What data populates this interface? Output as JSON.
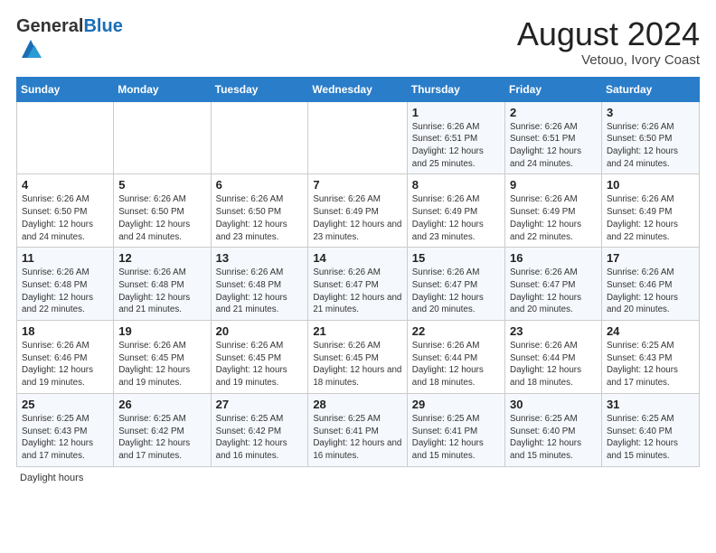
{
  "header": {
    "logo_general": "General",
    "logo_blue": "Blue",
    "month_title": "August 2024",
    "location": "Vetouo, Ivory Coast"
  },
  "days_of_week": [
    "Sunday",
    "Monday",
    "Tuesday",
    "Wednesday",
    "Thursday",
    "Friday",
    "Saturday"
  ],
  "weeks": [
    [
      {
        "day": "",
        "info": ""
      },
      {
        "day": "",
        "info": ""
      },
      {
        "day": "",
        "info": ""
      },
      {
        "day": "",
        "info": ""
      },
      {
        "day": "1",
        "info": "Sunrise: 6:26 AM\nSunset: 6:51 PM\nDaylight: 12 hours and 25 minutes."
      },
      {
        "day": "2",
        "info": "Sunrise: 6:26 AM\nSunset: 6:51 PM\nDaylight: 12 hours and 24 minutes."
      },
      {
        "day": "3",
        "info": "Sunrise: 6:26 AM\nSunset: 6:50 PM\nDaylight: 12 hours and 24 minutes."
      }
    ],
    [
      {
        "day": "4",
        "info": "Sunrise: 6:26 AM\nSunset: 6:50 PM\nDaylight: 12 hours and 24 minutes."
      },
      {
        "day": "5",
        "info": "Sunrise: 6:26 AM\nSunset: 6:50 PM\nDaylight: 12 hours and 24 minutes."
      },
      {
        "day": "6",
        "info": "Sunrise: 6:26 AM\nSunset: 6:50 PM\nDaylight: 12 hours and 23 minutes."
      },
      {
        "day": "7",
        "info": "Sunrise: 6:26 AM\nSunset: 6:49 PM\nDaylight: 12 hours and 23 minutes."
      },
      {
        "day": "8",
        "info": "Sunrise: 6:26 AM\nSunset: 6:49 PM\nDaylight: 12 hours and 23 minutes."
      },
      {
        "day": "9",
        "info": "Sunrise: 6:26 AM\nSunset: 6:49 PM\nDaylight: 12 hours and 22 minutes."
      },
      {
        "day": "10",
        "info": "Sunrise: 6:26 AM\nSunset: 6:49 PM\nDaylight: 12 hours and 22 minutes."
      }
    ],
    [
      {
        "day": "11",
        "info": "Sunrise: 6:26 AM\nSunset: 6:48 PM\nDaylight: 12 hours and 22 minutes."
      },
      {
        "day": "12",
        "info": "Sunrise: 6:26 AM\nSunset: 6:48 PM\nDaylight: 12 hours and 21 minutes."
      },
      {
        "day": "13",
        "info": "Sunrise: 6:26 AM\nSunset: 6:48 PM\nDaylight: 12 hours and 21 minutes."
      },
      {
        "day": "14",
        "info": "Sunrise: 6:26 AM\nSunset: 6:47 PM\nDaylight: 12 hours and 21 minutes."
      },
      {
        "day": "15",
        "info": "Sunrise: 6:26 AM\nSunset: 6:47 PM\nDaylight: 12 hours and 20 minutes."
      },
      {
        "day": "16",
        "info": "Sunrise: 6:26 AM\nSunset: 6:47 PM\nDaylight: 12 hours and 20 minutes."
      },
      {
        "day": "17",
        "info": "Sunrise: 6:26 AM\nSunset: 6:46 PM\nDaylight: 12 hours and 20 minutes."
      }
    ],
    [
      {
        "day": "18",
        "info": "Sunrise: 6:26 AM\nSunset: 6:46 PM\nDaylight: 12 hours and 19 minutes."
      },
      {
        "day": "19",
        "info": "Sunrise: 6:26 AM\nSunset: 6:45 PM\nDaylight: 12 hours and 19 minutes."
      },
      {
        "day": "20",
        "info": "Sunrise: 6:26 AM\nSunset: 6:45 PM\nDaylight: 12 hours and 19 minutes."
      },
      {
        "day": "21",
        "info": "Sunrise: 6:26 AM\nSunset: 6:45 PM\nDaylight: 12 hours and 18 minutes."
      },
      {
        "day": "22",
        "info": "Sunrise: 6:26 AM\nSunset: 6:44 PM\nDaylight: 12 hours and 18 minutes."
      },
      {
        "day": "23",
        "info": "Sunrise: 6:26 AM\nSunset: 6:44 PM\nDaylight: 12 hours and 18 minutes."
      },
      {
        "day": "24",
        "info": "Sunrise: 6:25 AM\nSunset: 6:43 PM\nDaylight: 12 hours and 17 minutes."
      }
    ],
    [
      {
        "day": "25",
        "info": "Sunrise: 6:25 AM\nSunset: 6:43 PM\nDaylight: 12 hours and 17 minutes."
      },
      {
        "day": "26",
        "info": "Sunrise: 6:25 AM\nSunset: 6:42 PM\nDaylight: 12 hours and 17 minutes."
      },
      {
        "day": "27",
        "info": "Sunrise: 6:25 AM\nSunset: 6:42 PM\nDaylight: 12 hours and 16 minutes."
      },
      {
        "day": "28",
        "info": "Sunrise: 6:25 AM\nSunset: 6:41 PM\nDaylight: 12 hours and 16 minutes."
      },
      {
        "day": "29",
        "info": "Sunrise: 6:25 AM\nSunset: 6:41 PM\nDaylight: 12 hours and 15 minutes."
      },
      {
        "day": "30",
        "info": "Sunrise: 6:25 AM\nSunset: 6:40 PM\nDaylight: 12 hours and 15 minutes."
      },
      {
        "day": "31",
        "info": "Sunrise: 6:25 AM\nSunset: 6:40 PM\nDaylight: 12 hours and 15 minutes."
      }
    ]
  ],
  "footer": {
    "note": "Daylight hours"
  }
}
